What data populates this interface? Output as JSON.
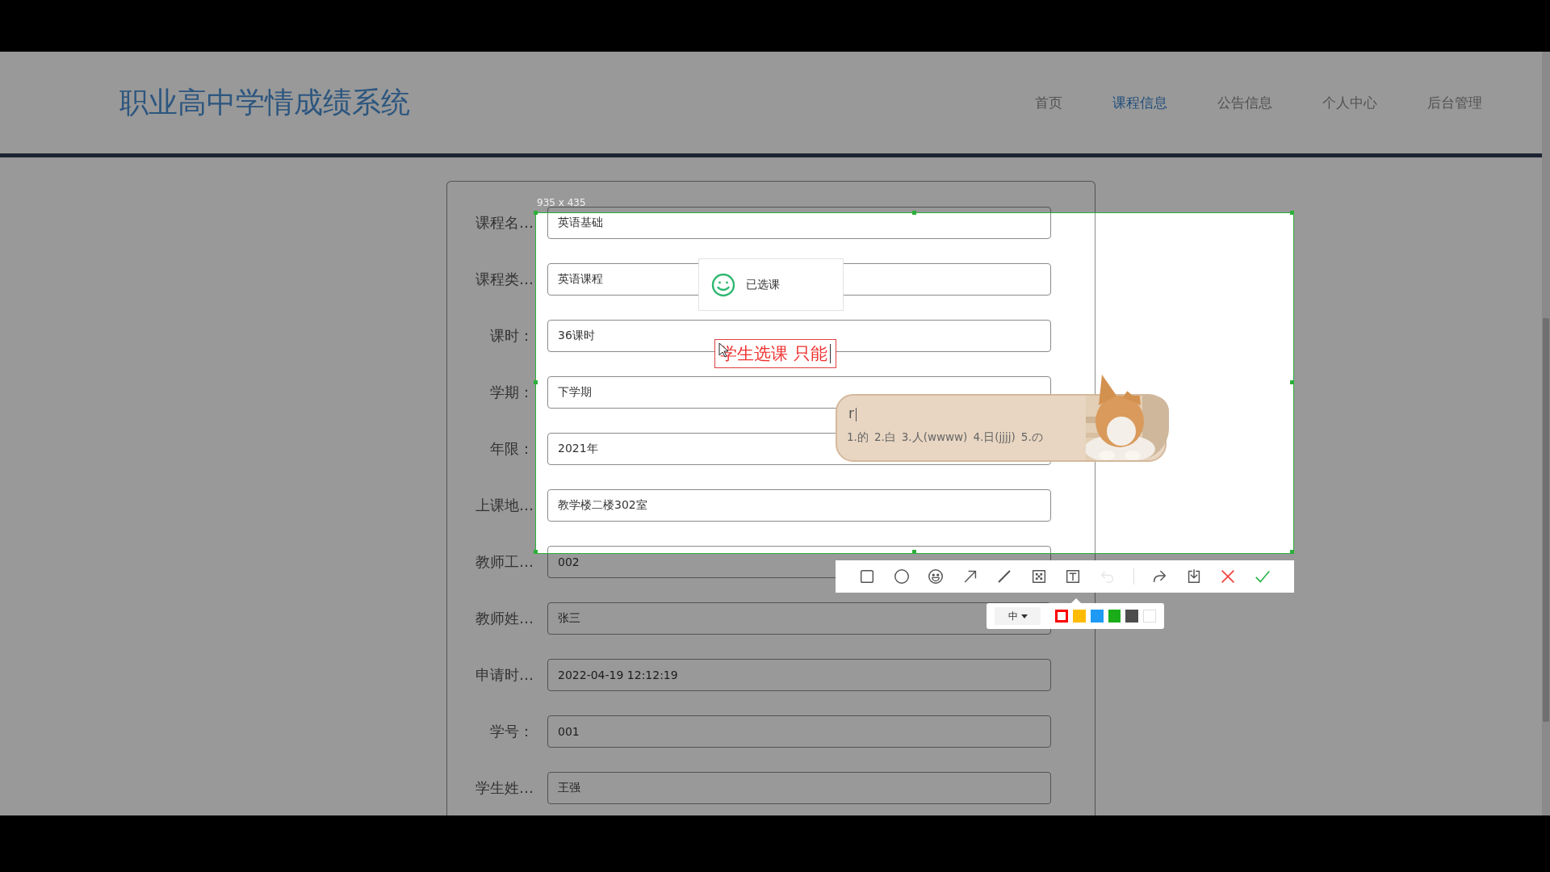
{
  "app_title": "职业高中学情成绩系统",
  "nav": [
    {
      "label": "首页",
      "selected": false
    },
    {
      "label": "课程信息",
      "selected": true
    },
    {
      "label": "公告信息",
      "selected": false
    },
    {
      "label": "个人中心",
      "selected": false
    },
    {
      "label": "后台管理",
      "selected": false
    }
  ],
  "form": {
    "fields": [
      {
        "label": "课程名…",
        "value": "英语基础"
      },
      {
        "label": "课程类…",
        "value": "英语课程"
      },
      {
        "label": "课时：",
        "value": "36课时"
      },
      {
        "label": "学期：",
        "value": "下学期"
      },
      {
        "label": "年限：",
        "value": "2021年"
      },
      {
        "label": "上课地…",
        "value": "教学楼二楼302室"
      },
      {
        "label": "教师工…",
        "value": "002"
      },
      {
        "label": "教师姓…",
        "value": "张三"
      },
      {
        "label": "申请时…",
        "value": "2022-04-19 12:12:19"
      },
      {
        "label": "学号：",
        "value": "001"
      },
      {
        "label": "学生姓…",
        "value": "王强"
      }
    ]
  },
  "capture": {
    "size_label": "935 x 435",
    "toast": "已选课",
    "text_annotation": "学生选课 只能",
    "ime": {
      "input": "r",
      "candidates": [
        "1.的",
        "2.白",
        "3.人(wwww)",
        "4.日(jjjj)",
        "5.の"
      ]
    },
    "tools": [
      {
        "kind": "rect",
        "disabled": false
      },
      {
        "kind": "ellipse",
        "disabled": false
      },
      {
        "kind": "emoji",
        "disabled": false
      },
      {
        "kind": "arrow",
        "disabled": false
      },
      {
        "kind": "pen",
        "disabled": false
      },
      {
        "kind": "mosaic",
        "disabled": false
      },
      {
        "kind": "text",
        "disabled": false
      },
      {
        "kind": "undo",
        "disabled": true
      },
      {
        "kind": "separator",
        "disabled": false
      },
      {
        "kind": "share",
        "disabled": false
      },
      {
        "kind": "download",
        "disabled": false
      },
      {
        "kind": "cancel",
        "disabled": false
      },
      {
        "kind": "confirm",
        "disabled": false
      }
    ],
    "pen_size": "中",
    "colors": [
      {
        "color": "#ff0000",
        "selected": true
      },
      {
        "color": "#ffbb00",
        "selected": false
      },
      {
        "color": "#1e9af5",
        "selected": false
      },
      {
        "color": "#1aad19",
        "selected": false
      },
      {
        "color": "#4d4d4d",
        "selected": false
      },
      {
        "color": "#ffffff",
        "selected": false
      }
    ]
  }
}
